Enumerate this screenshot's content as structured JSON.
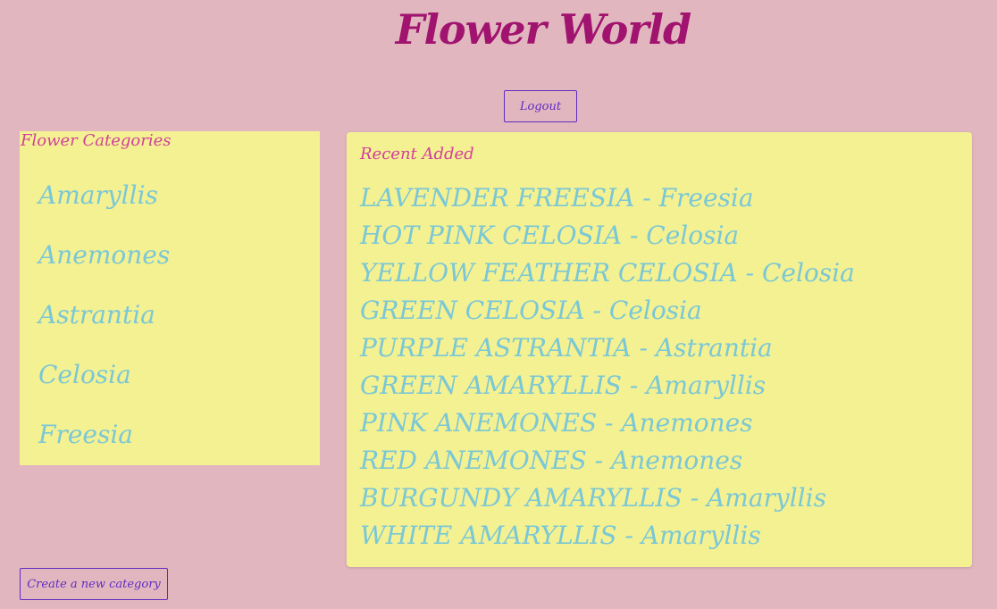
{
  "header": {
    "title": "Flower World",
    "logout_label": "Logout"
  },
  "categories": {
    "heading": "Flower Categories",
    "items": [
      "Amaryllis",
      "Anemones",
      "Astrantia",
      "Celosia",
      "Freesia"
    ],
    "create_label": "Create a new category"
  },
  "recent": {
    "heading": "Recent Added",
    "items": [
      "LAVENDER FREESIA - Freesia",
      "HOT PINK CELOSIA - Celosia",
      "YELLOW FEATHER CELOSIA - Celosia",
      "GREEN CELOSIA - Celosia",
      "PURPLE ASTRANTIA - Astrantia",
      "GREEN AMARYLLIS - Amaryllis",
      "PINK ANEMONES - Anemones",
      "RED ANEMONES - Anemones",
      "BURGUNDY AMARYLLIS - Amaryllis",
      "WHITE AMARYLLIS - Amaryllis"
    ]
  },
  "colors": {
    "background": "#e2b6bf",
    "panel": "#f4f192",
    "title": "#a0136e",
    "heading": "#d1409a",
    "link": "#7ac7d6",
    "button": "#5f2bc2"
  }
}
